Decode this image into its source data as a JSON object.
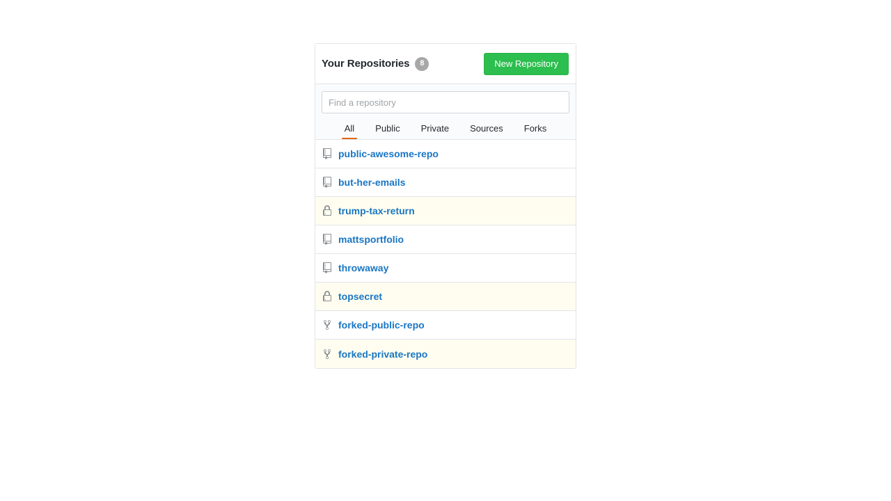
{
  "card": {
    "title": "Your Repositories",
    "count_badge": "8",
    "new_repository_label": "New Repository"
  },
  "search": {
    "placeholder": "Find a repository",
    "value": ""
  },
  "tabs": [
    {
      "label": "All",
      "active": true
    },
    {
      "label": "Public",
      "active": false
    },
    {
      "label": "Private",
      "active": false
    },
    {
      "label": "Sources",
      "active": false
    },
    {
      "label": "Forks",
      "active": false
    }
  ],
  "repositories": [
    {
      "name": "public-awesome-repo",
      "icon": "repo-icon",
      "private": false
    },
    {
      "name": "but-her-emails",
      "icon": "repo-icon",
      "private": false
    },
    {
      "name": "trump-tax-return",
      "icon": "lock-icon",
      "private": true
    },
    {
      "name": "mattsportfolio",
      "icon": "repo-icon",
      "private": false
    },
    {
      "name": "throwaway",
      "icon": "repo-icon",
      "private": false
    },
    {
      "name": "topsecret",
      "icon": "lock-icon",
      "private": true
    },
    {
      "name": "forked-public-repo",
      "icon": "repo-forked-icon",
      "private": false
    },
    {
      "name": "forked-private-repo",
      "icon": "repo-forked-icon",
      "private": true
    }
  ],
  "colors": {
    "accent_green": "#2cbe4e",
    "link_blue": "#1976c4",
    "active_tab_underline": "#e36209",
    "private_row_background": "#fffdef",
    "border": "#e1e4e8",
    "badge_gray": "#a8a8a8"
  }
}
